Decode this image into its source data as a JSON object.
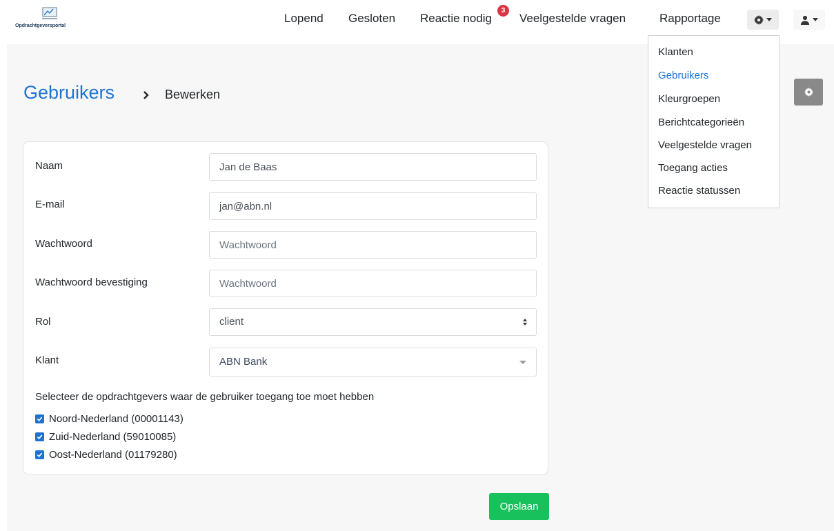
{
  "brand": {
    "name": "Opdrachtgeversportal",
    "icon": "portal-logo-icon"
  },
  "nav": {
    "links": [
      "Lopend",
      "Gesloten",
      "Reactie nodig",
      "Veelgestelde vragen",
      "Rapportage"
    ],
    "badge_count": "3",
    "settings_icon": "gear-icon",
    "user_icon": "user-icon"
  },
  "page": {
    "title": "Gebruikers",
    "subtitle": "Bewerken"
  },
  "form": {
    "name_label": "Naam",
    "name_value": "Jan de Baas",
    "email_label": "E-mail",
    "email_value": "jan@abn.nl",
    "password_label": "Wachtwoord",
    "password_placeholder": "Wachtwoord",
    "password_confirm_label": "Wachtwoord bevestiging",
    "password_confirm_placeholder": "Wachtwoord",
    "role_label": "Rol",
    "role_value": "client",
    "client_label": "Klant",
    "client_value": "ABN Bank",
    "instruction": "Selecteer de opdrachtgevers waar de gebruiker toegang toe moet hebben",
    "checkboxes": [
      {
        "label": "Noord-Nederland (00001143)",
        "checked": true
      },
      {
        "label": "Zuid-Nederland (59010085)",
        "checked": true
      },
      {
        "label": "Oost-Nederland (01179280)",
        "checked": true
      }
    ],
    "save_label": "Opslaan"
  },
  "settings_menu": {
    "items": [
      "Klanten",
      "Gebruikers",
      "Kleurgroepen",
      "Berichtcategorieën",
      "Veelgestelde vragen",
      "Toegang acties",
      "Reactie statussen"
    ],
    "active_index": 1
  },
  "colors": {
    "primary": "#1e73d1",
    "success": "#18c15b",
    "danger": "#dc3545",
    "background": "#f7f7f7"
  }
}
